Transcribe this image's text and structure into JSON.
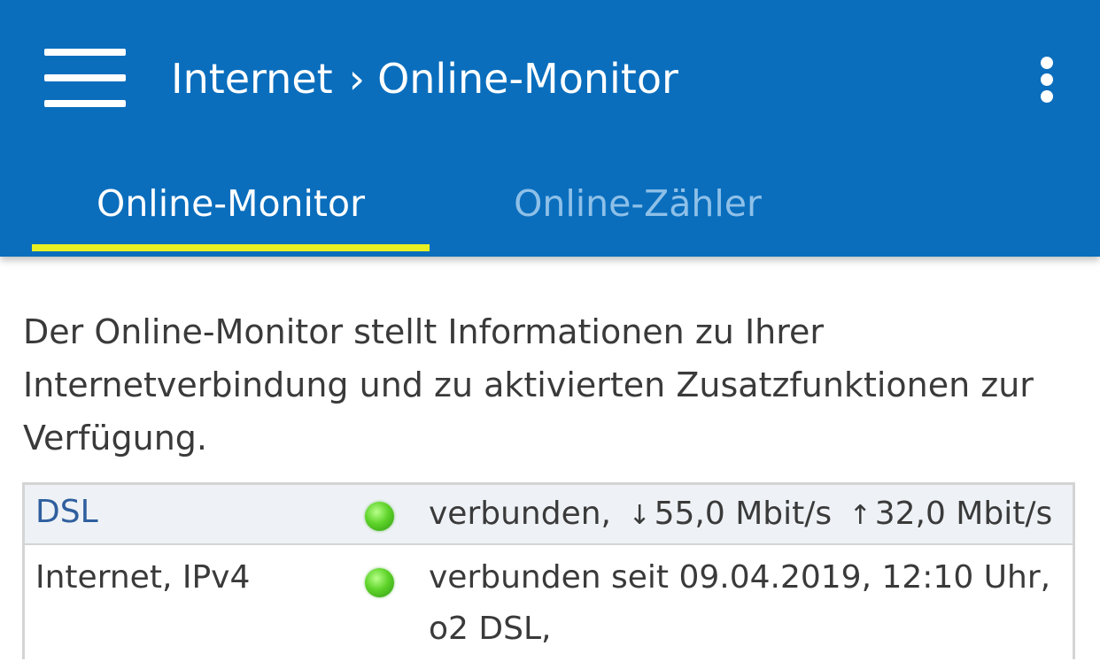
{
  "header": {
    "breadcrumb": [
      "Internet",
      "Online-Monitor"
    ],
    "breadcrumb_separator": "›",
    "menu_icon": "hamburger-menu-icon",
    "overflow_icon": "more-vert-icon",
    "background_color": "#0a6ebd"
  },
  "tabs": [
    {
      "label": "Online-Monitor",
      "active": true
    },
    {
      "label": "Online-Zähler",
      "active": false
    }
  ],
  "tab_indicator_color": "#e8f023",
  "intro_text": "Der Online-Monitor stellt Informationen zu Ihrer Internetverbindung und zu aktivierten Zusatzfunktionen zur Verfügung.",
  "status_rows": [
    {
      "label": "DSL",
      "led_status": "green",
      "status": "verbunden,",
      "down_arrow": "↓",
      "down": "55,0 Mbit/s",
      "up_arrow": "↑",
      "up": "32,0 Mbit/s"
    },
    {
      "label": "Internet, IPv4",
      "led_status": "green",
      "line1": "verbunden seit 09.04.2019, 12:10 Uhr,",
      "line2": "o2 DSL,"
    }
  ]
}
